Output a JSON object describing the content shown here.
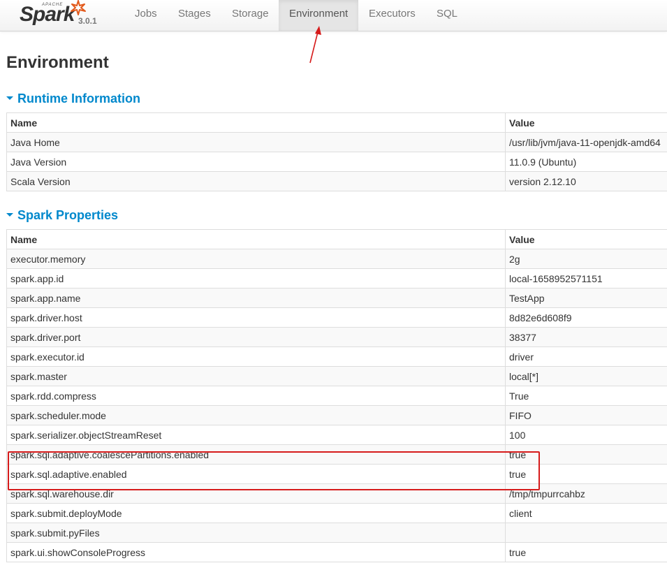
{
  "header": {
    "brand_small": "APACHE",
    "brand": "Spark",
    "version": "3.0.1",
    "tabs": [
      {
        "label": "Jobs",
        "active": false
      },
      {
        "label": "Stages",
        "active": false
      },
      {
        "label": "Storage",
        "active": false
      },
      {
        "label": "Environment",
        "active": true
      },
      {
        "label": "Executors",
        "active": false
      },
      {
        "label": "SQL",
        "active": false
      }
    ]
  },
  "page_title": "Environment",
  "runtime": {
    "title": "Runtime Information",
    "col_name": "Name",
    "col_value": "Value",
    "rows": [
      {
        "name": "Java Home",
        "value": "/usr/lib/jvm/java-11-openjdk-amd64"
      },
      {
        "name": "Java Version",
        "value": "11.0.9 (Ubuntu)"
      },
      {
        "name": "Scala Version",
        "value": "version 2.12.10"
      }
    ]
  },
  "spark_props": {
    "title": "Spark Properties",
    "col_name": "Name",
    "col_value": "Value",
    "rows": [
      {
        "name": "executor.memory",
        "value": "2g"
      },
      {
        "name": "spark.app.id",
        "value": "local-1658952571151"
      },
      {
        "name": "spark.app.name",
        "value": "TestApp"
      },
      {
        "name": "spark.driver.host",
        "value": "8d82e6d608f9"
      },
      {
        "name": "spark.driver.port",
        "value": "38377"
      },
      {
        "name": "spark.executor.id",
        "value": "driver"
      },
      {
        "name": "spark.master",
        "value": "local[*]"
      },
      {
        "name": "spark.rdd.compress",
        "value": "True"
      },
      {
        "name": "spark.scheduler.mode",
        "value": "FIFO"
      },
      {
        "name": "spark.serializer.objectStreamReset",
        "value": "100"
      },
      {
        "name": "spark.sql.adaptive.coalescePartitions.enabled",
        "value": "true"
      },
      {
        "name": "spark.sql.adaptive.enabled",
        "value": "true"
      },
      {
        "name": "spark.sql.warehouse.dir",
        "value": "/tmp/tmpurrcahbz"
      },
      {
        "name": "spark.submit.deployMode",
        "value": "client"
      },
      {
        "name": "spark.submit.pyFiles",
        "value": ""
      },
      {
        "name": "spark.ui.showConsoleProgress",
        "value": "true"
      }
    ]
  },
  "colors": {
    "link": "#0088cc",
    "annotation": "#d61b1b",
    "active_tab_bg": "#e5e5e5",
    "spark_logo_star": "#e25a1c"
  }
}
